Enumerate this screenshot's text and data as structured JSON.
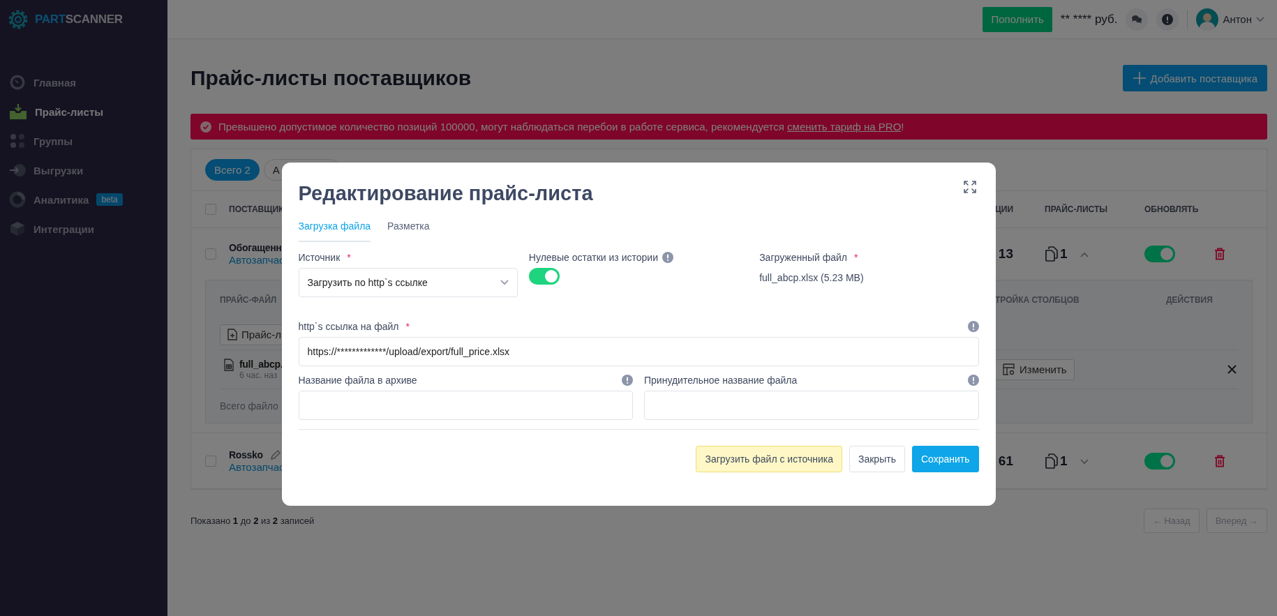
{
  "brand": {
    "part_a": "PART",
    "part_b": "SCANNER"
  },
  "sidebar": {
    "items": [
      {
        "label": "Главная",
        "selected": false
      },
      {
        "label": "Прайс-листы",
        "selected": true
      },
      {
        "label": "Группы",
        "selected": false
      },
      {
        "label": "Выгрузки",
        "selected": false
      },
      {
        "label": "Аналитика",
        "selected": false,
        "badge": "beta"
      },
      {
        "label": "Интеграции",
        "selected": false
      }
    ]
  },
  "header": {
    "topup_button": "Пополнить",
    "balance": "** **** руб.",
    "user_name": "Антон"
  },
  "page": {
    "title": "Прайс-листы поставщиков",
    "add_button": "Добавить поставщика"
  },
  "alert": {
    "text": "Превышено допустимое количество позиций 100000, могут наблюдаться перебои в работе сервиса, рекомендуется ",
    "link": "сменить тариф на PRO",
    "suffix": "!"
  },
  "table": {
    "filters": [
      {
        "label": "Всего 2",
        "selected": true
      },
      {
        "label": "А",
        "selected": false
      }
    ],
    "select_all_checked": false,
    "columns": [
      "ПОСТАВЩИК",
      "ЦИИ",
      "ПРАЙС-ЛИСТЫ",
      "ОБНОВЛЯТЬ"
    ],
    "rows": [
      {
        "name": "Обогащенн",
        "category": "Автозапчас",
        "count": "13",
        "files": "1",
        "checked": false,
        "expanded": true,
        "update": true,
        "editable": false
      },
      {
        "name": "Rossko",
        "category": "Автозапчас",
        "count": "61",
        "files": "1",
        "checked": false,
        "expanded": false,
        "update": true,
        "editable": true
      }
    ],
    "detail": {
      "columns": [
        "ПРАЙС-ФАЙЛ",
        "ТРОЙКА СТОЛБЦОВ",
        "ДЕЙСТВИЯ"
      ],
      "add_button": "Прайс-л",
      "file_name": "full_abcp.",
      "file_age": "6 час. наз",
      "edit_button": "Изменить",
      "total": "Всего файло"
    }
  },
  "footer": {
    "summary": "Показано **1** до **2** из **2** записей",
    "prev": {
      "label": "← Назад",
      "disabled": true
    },
    "next": {
      "label": "Вперед →",
      "disabled": true
    }
  },
  "modal": {
    "title": "Редактирование прайс-листа",
    "tabs": [
      {
        "label": "Загрузка файла",
        "selected": true
      },
      {
        "label": "Разметка",
        "selected": false
      }
    ],
    "source": {
      "label": "Источник",
      "required_mark": "*",
      "value": "Загрузить по http`s ссылке"
    },
    "zero_stock": {
      "label": "Нулевые остатки из истории",
      "on": true
    },
    "uploaded": {
      "label": "Загруженный файл",
      "required_mark": "*",
      "value": "full_abcp.xlsx (5.23 MB)"
    },
    "link": {
      "label": "http`s ссылка на файл",
      "required_mark": "*",
      "value": "https://*************/upload/export/full_price.xlsx"
    },
    "archive_name": {
      "label": "Название файла в архиве"
    },
    "forced_name": {
      "label": "Принудительное название файла"
    },
    "buttons": {
      "fetch": "Загрузить файл с источника",
      "close": "Закрыть",
      "save": "Сохранить"
    }
  }
}
